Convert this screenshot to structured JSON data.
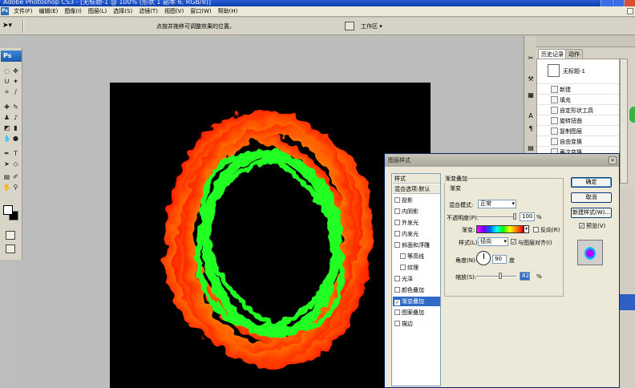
{
  "app": {
    "title": "Adobe Photoshop CS3 - [无标题-1 @ 100% (形状 1 副本 6, RGB/8)]",
    "logo": "Ps"
  },
  "menu": [
    "文件(F)",
    "编辑(E)",
    "图像(I)",
    "图层(L)",
    "选择(S)",
    "滤镜(T)",
    "视图(V)",
    "窗口(W)",
    "帮助(H)"
  ],
  "options": {
    "hint": "点按并拖移可调整效果的位置。",
    "workspace_label": "工作区 ▾"
  },
  "history_panel": {
    "tabs": [
      "历史记录 ×",
      "动作"
    ],
    "snapshot_label": "无标题-1",
    "items": [
      "新建",
      "填充",
      "自定形状工具",
      "旋转扭曲",
      "复制图层",
      "自由变换",
      "再次变换"
    ]
  },
  "dialog": {
    "title": "图层样式",
    "list_header": "样式",
    "blend_options": "混合选项:默认",
    "styles": [
      {
        "label": "投影",
        "checked": false,
        "indent": false,
        "selected": false
      },
      {
        "label": "内阴影",
        "checked": false,
        "indent": false,
        "selected": false
      },
      {
        "label": "外发光",
        "checked": false,
        "indent": false,
        "selected": false
      },
      {
        "label": "内发光",
        "checked": false,
        "indent": false,
        "selected": false
      },
      {
        "label": "斜面和浮雕",
        "checked": false,
        "indent": false,
        "selected": false
      },
      {
        "label": "等高线",
        "checked": false,
        "indent": true,
        "selected": false
      },
      {
        "label": "纹理",
        "checked": false,
        "indent": true,
        "selected": false
      },
      {
        "label": "光泽",
        "checked": false,
        "indent": false,
        "selected": false
      },
      {
        "label": "颜色叠加",
        "checked": false,
        "indent": false,
        "selected": false
      },
      {
        "label": "渐变叠加",
        "checked": true,
        "indent": false,
        "selected": true
      },
      {
        "label": "图案叠加",
        "checked": false,
        "indent": false,
        "selected": false
      },
      {
        "label": "描边",
        "checked": false,
        "indent": false,
        "selected": false
      }
    ],
    "section_title": "渐变叠加",
    "sub_title": "渐变",
    "blend_mode_label": "混合模式:",
    "blend_mode_value": "正常",
    "opacity_label": "不透明度(P):",
    "opacity_value": "100",
    "opacity_unit": "%",
    "gradient_label": "渐变:",
    "reverse_label": "反向(R)",
    "style_label": "样式(L):",
    "style_value": "径向",
    "align_label": "与图层对齐(I)",
    "angle_label": "角度(N):",
    "angle_value": "90",
    "angle_unit": "度",
    "scale_label": "缩放(S):",
    "scale_value": "82",
    "scale_unit": "%",
    "buttons": {
      "ok": "确定",
      "cancel": "取消",
      "new_style": "新建样式(W)...",
      "preview": "预览(V)"
    },
    "preview_checked": true,
    "align_checked": true,
    "reverse_checked": false
  },
  "artwork": {
    "ring_colors": [
      "#ff1a00",
      "#ff8a00",
      "#ffff00",
      "#22ff22"
    ]
  }
}
